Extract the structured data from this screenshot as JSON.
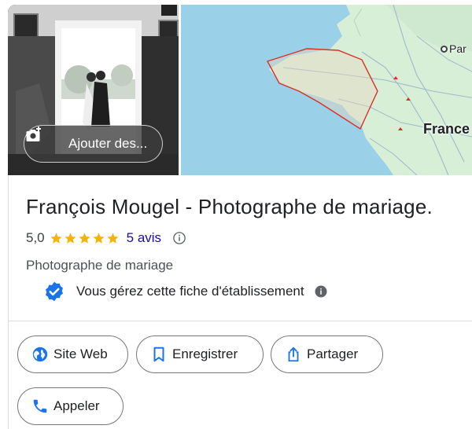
{
  "header": {
    "add_photos_label": "Ajouter des...",
    "map_labels": {
      "france": "France",
      "paris": "Par"
    }
  },
  "business": {
    "name": "François Mougel - Photographe de mariage.",
    "rating": "5,0",
    "stars": 5,
    "reviews_label": "5 avis",
    "category": "Photographe de mariage",
    "verified_text": "Vous gérez cette fiche d'établissement"
  },
  "actions": {
    "website_label": "Site Web",
    "save_label": "Enregistrer",
    "share_label": "Partager",
    "call_label": "Appeler"
  },
  "colors": {
    "accent": "#1a73e8",
    "link": "#1a0dab",
    "star": "#f5b400",
    "verified_badge": "#1a73e8",
    "map_water": "#9ad0e8",
    "map_land": "#d7efd7",
    "service_area": "#d93025"
  },
  "icons": {
    "add_photo": "camera-plus-icon",
    "website": "globe-icon",
    "save": "bookmark-icon",
    "share": "share-icon",
    "call": "phone-icon",
    "verified": "verified-badge-icon",
    "info": "info-icon"
  }
}
